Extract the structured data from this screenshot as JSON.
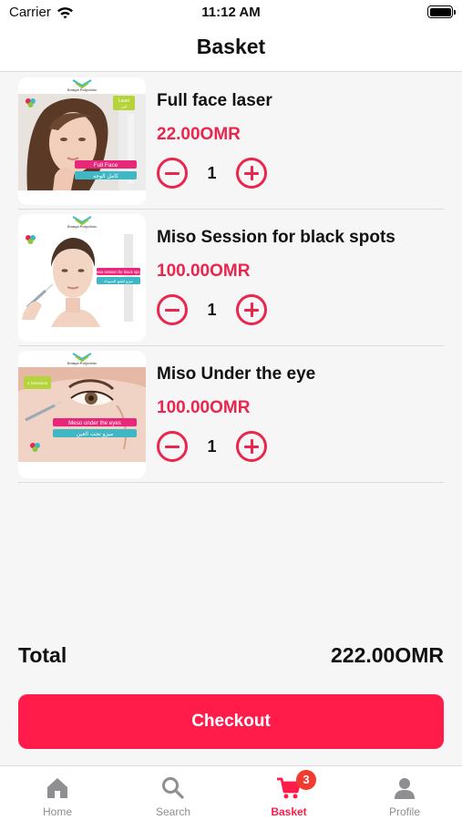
{
  "status_bar": {
    "carrier": "Carrier",
    "time": "11:12 AM"
  },
  "header": {
    "title": "Basket"
  },
  "basket": {
    "items": [
      {
        "name": "Full face laser",
        "price": "22.00OMR",
        "quantity": "1",
        "image": {
          "brand": "Smaya Polyclinic",
          "tag": "Laser",
          "tag_ar": "ليزر",
          "caption": "Full Face",
          "caption_ar": "كامل الوجه"
        }
      },
      {
        "name": "Miso Session for black spots",
        "price": "100.00OMR",
        "quantity": "1",
        "image": {
          "brand": "Smaya Polyclinic",
          "caption": "Meso session for black spots",
          "caption_ar": "ميزو للبقع السوداء"
        }
      },
      {
        "name": "Miso Under the eye",
        "price": "100.00OMR",
        "quantity": "1",
        "image": {
          "brand": "Smaya Polyclinic",
          "sessions": "4 Sessions",
          "caption": "Meso under the eyes",
          "caption_ar": "ميزو تحت العين"
        }
      }
    ]
  },
  "summary": {
    "total_label": "Total",
    "total_value": "222.00OMR"
  },
  "checkout": {
    "label": "Checkout"
  },
  "tabs": [
    {
      "label": "Home",
      "icon": "home-icon"
    },
    {
      "label": "Search",
      "icon": "search-icon"
    },
    {
      "label": "Basket",
      "icon": "cart-icon",
      "badge": "3",
      "active": true
    },
    {
      "label": "Profile",
      "icon": "profile-icon"
    }
  ],
  "colors": {
    "accent": "#ff1c4b",
    "price": "#e8264e",
    "badge": "#f23a2f",
    "inactive_tab": "#8e8e93",
    "background": "#f6f6f6"
  }
}
